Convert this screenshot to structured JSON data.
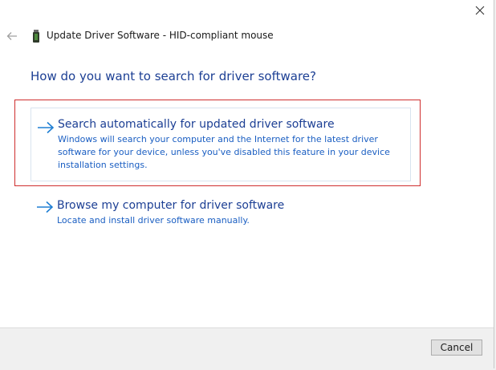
{
  "window": {
    "title": "Update Driver Software - HID-compliant mouse",
    "close_icon": "close-icon",
    "back_icon": "back-arrow-icon",
    "title_icon": "usb-device-icon"
  },
  "main": {
    "heading": "How do you want to search for driver software?",
    "options": [
      {
        "icon": "arrow-right-icon",
        "title": "Search automatically for updated driver software",
        "description": "Windows will search your computer and the Internet for the latest driver software for your device, unless you've disabled this feature in your device installation settings.",
        "selected": true
      },
      {
        "icon": "arrow-right-icon",
        "title": "Browse my computer for driver software",
        "description": "Locate and install driver software manually.",
        "selected": false
      }
    ]
  },
  "footer": {
    "cancel_label": "Cancel"
  },
  "colors": {
    "heading": "#1c3f94",
    "link_text": "#1a5ec2",
    "arrow": "#1f7fd4",
    "focus_ring": "#cf2e2e"
  }
}
